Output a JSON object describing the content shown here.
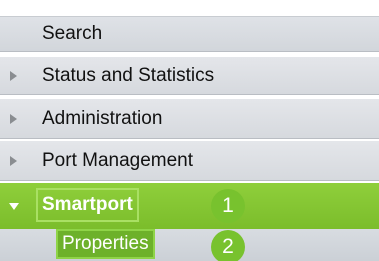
{
  "menu": {
    "search": "Search",
    "status": "Status and Statistics",
    "administration": "Administration",
    "port_management": "Port Management",
    "smartport": "Smartport",
    "properties": "Properties"
  },
  "callouts": {
    "step1": "1",
    "step2": "2"
  },
  "colors": {
    "active_green": "#7bbd2b",
    "menu_gray": "#d6d9de",
    "badge_green": "#78c22e"
  }
}
